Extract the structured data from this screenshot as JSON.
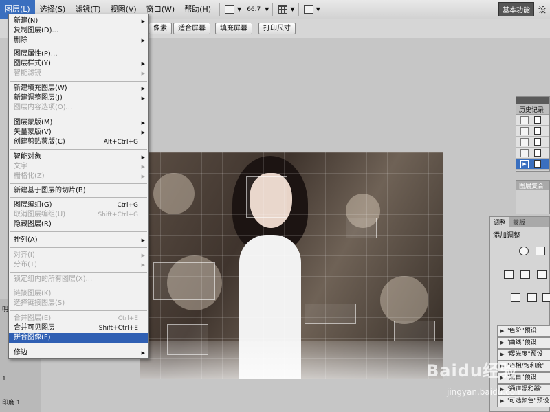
{
  "menubar": {
    "items": [
      "图层(L)",
      "选择(S)",
      "滤镜(T)",
      "视图(V)",
      "窗口(W)",
      "帮助(H)"
    ],
    "zoom": "66.7",
    "workspace": "基本功能",
    "workspace_next": "设"
  },
  "options_bar": {
    "buttons": [
      "像素",
      "适合屏幕",
      "填充屏幕",
      "打印尺寸"
    ]
  },
  "left_panel": {
    "items": [
      "明",
      "1",
      "印度 1"
    ]
  },
  "history_panel": {
    "tab": "历史记录",
    "rows": 5,
    "selected_row": 5
  },
  "layer_comp_panel": {
    "tab": "图层复合"
  },
  "adjust_panel": {
    "tabs": [
      "调整",
      "蒙版"
    ],
    "title": "添加调整",
    "presets": [
      "\"色阶\"预设",
      "\"曲线\"预设",
      "\"曝光度\"预设",
      "\"色相/饱和度\"",
      "\"黑白\"预设",
      "\"通道混和器\"",
      "\"可选颜色\"预设"
    ]
  },
  "layer_menu": {
    "items": [
      {
        "label": "新建(N)",
        "submenu": true
      },
      {
        "label": "复制图层(D)...",
        "submenu": false
      },
      {
        "label": "删除",
        "submenu": true
      },
      {
        "label": "图层属性(P)...",
        "submenu": false
      },
      {
        "label": "图层样式(Y)",
        "submenu": true
      },
      {
        "label": "智能滤镜",
        "submenu": true,
        "disabled": true
      },
      {
        "label": "新建填充图层(W)",
        "submenu": true
      },
      {
        "label": "新建调整图层(J)",
        "submenu": true
      },
      {
        "label": "图层内容选项(O)...",
        "submenu": false,
        "disabled": true
      },
      {
        "label": "图层蒙版(M)",
        "submenu": true
      },
      {
        "label": "矢量蒙版(V)",
        "submenu": true
      },
      {
        "label": "创建剪贴蒙版(C)",
        "shortcut": "Alt+Ctrl+G"
      },
      {
        "label": "智能对象",
        "submenu": true
      },
      {
        "label": "文字",
        "submenu": true,
        "disabled": true
      },
      {
        "label": "栅格化(Z)",
        "submenu": true,
        "disabled": true
      },
      {
        "label": "新建基于图层的切片(B)"
      },
      {
        "label": "图层编组(G)",
        "shortcut": "Ctrl+G"
      },
      {
        "label": "取消图层编组(U)",
        "shortcut": "Shift+Ctrl+G",
        "disabled": true
      },
      {
        "label": "隐藏图层(R)"
      },
      {
        "label": "排列(A)",
        "submenu": true
      },
      {
        "label": "对齐(I)",
        "submenu": true,
        "disabled": true
      },
      {
        "label": "分布(T)",
        "submenu": true,
        "disabled": true
      },
      {
        "label": "锁定组内的所有图层(X)...",
        "disabled": true
      },
      {
        "label": "链接图层(K)",
        "disabled": true
      },
      {
        "label": "选择链接图层(S)",
        "disabled": true
      },
      {
        "label": "合并图层(E)",
        "shortcut": "Ctrl+E",
        "disabled": true
      },
      {
        "label": "合并可见图层",
        "shortcut": "Shift+Ctrl+E"
      },
      {
        "label": "拼合图像(F)",
        "highlighted": true
      },
      {
        "label": "修边",
        "submenu": true
      }
    ]
  },
  "watermark": {
    "logo": "Baidu经验",
    "url": "jingyan.baidu.com"
  }
}
